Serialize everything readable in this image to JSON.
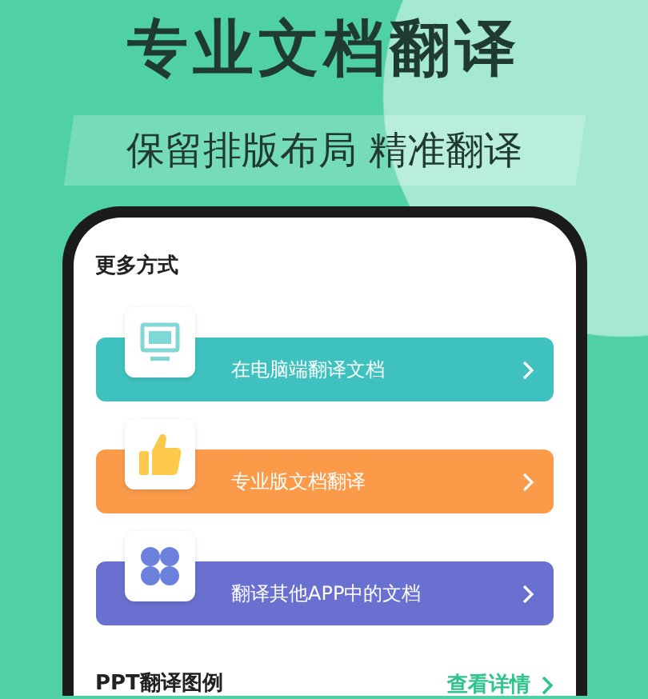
{
  "headline": "专业文档翻译",
  "subtitle": "保留排版布局 精准翻译",
  "screen": {
    "section_title": "更多方式",
    "options": [
      {
        "kind": "computer",
        "label": "在电脑端翻译文档",
        "color": "#3fc2bf"
      },
      {
        "kind": "thumb",
        "label": "专业版文档翻译",
        "color": "#fb9b4a"
      },
      {
        "kind": "apps",
        "label": "翻译其他APP中的文档",
        "color": "#6a70cf"
      }
    ],
    "example_title": "PPT翻译图例",
    "details_link": "查看详情"
  }
}
